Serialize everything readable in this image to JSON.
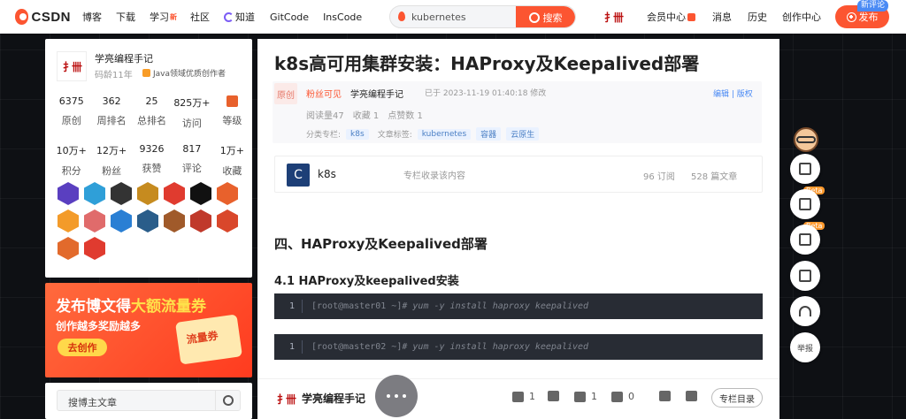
{
  "topbar": {
    "logo": "CSDN",
    "nav": [
      {
        "label": "博客",
        "hot": ""
      },
      {
        "label": "下载",
        "hot": ""
      },
      {
        "label": "学习",
        "hot": "新"
      },
      {
        "label": "社区",
        "hot": ""
      },
      {
        "label": "知道",
        "hot": ""
      },
      {
        "label": "GitCode",
        "hot": ""
      },
      {
        "label": "InsCode",
        "hot": ""
      }
    ],
    "search_query": "kubernetes",
    "search_button": "搜索",
    "member_center": "会员中心",
    "messages": "消息",
    "history": "历史",
    "creation_center": "创作中心",
    "publish": "发布",
    "new_comment": "新评论"
  },
  "profile": {
    "name": "学亮编程手记",
    "code_age": "码龄11年",
    "badge": "Java领域优质创作者",
    "stats_row1": [
      {
        "value": "6375",
        "label": "原创"
      },
      {
        "value": "362",
        "label": "周排名"
      },
      {
        "value": "25",
        "label": "总排名"
      },
      {
        "value": "825万+",
        "label": "访问"
      },
      {
        "value": "",
        "label": "等级"
      }
    ],
    "stats_row2": [
      {
        "value": "10万+",
        "label": "积分"
      },
      {
        "value": "12万+",
        "label": "粉丝"
      },
      {
        "value": "9326",
        "label": "获赞"
      },
      {
        "value": "817",
        "label": "评论"
      },
      {
        "value": "1万+",
        "label": "收藏"
      }
    ],
    "medal_colors": [
      "#5a3fc0",
      "#2f9fd8",
      "#333",
      "#c68b1f",
      "#e03b2f",
      "#111",
      "#e8612c",
      "#f39b2a",
      "#e06b6b",
      "#2a7fd4",
      "#2a5d8a",
      "#a05a2a",
      "#c0392b",
      "#d9472b",
      "#e26a2c",
      "#e03b2f"
    ]
  },
  "banner": {
    "title_a": "发布博文得",
    "title_b": "大额流量券",
    "subtitle": "创作越多奖励越多",
    "button": "去创作",
    "coupon": "流量券"
  },
  "blog_search": {
    "placeholder": "搜博主文章"
  },
  "article": {
    "title": "k8s高可用集群安装：HAProxy及Keepalived部署",
    "original": "原创",
    "fans_visible": "粉丝可见",
    "author": "学亮编程手记",
    "time": "已于 2023-11-19 01:40:18 修改",
    "edit": "编辑",
    "copyright": "版权",
    "reads": "阅读量47",
    "favorites": "收藏 1",
    "likes": "点赞数 1",
    "column_label": "分类专栏:",
    "column_tag": "k8s",
    "article_tags_label": "文章标签:",
    "tags": [
      "kubernetes",
      "容器",
      "云原生"
    ],
    "column_box": {
      "icon_letter": "C",
      "name": "k8s",
      "desc": "专栏收录该内容",
      "subs": "96 订阅",
      "posts": "528 篇文章"
    },
    "h2": "四、HAProxy及Keepalived部署",
    "h3": "4.1 HAProxy及keepalived安装",
    "code_blocks": [
      {
        "line": "1",
        "prompt": "[root@master01 ~]",
        "comment": "# yum -y install haproxy keepalived"
      },
      {
        "line": "1",
        "prompt": "[root@master02 ~]",
        "comment": "# yum -y install haproxy keepalived"
      }
    ]
  },
  "bottom_bar": {
    "name": "学亮编程手记",
    "likes": "1",
    "stars": "1",
    "comments": "0",
    "column_dir": "专栏目录"
  },
  "right_tools": {
    "beta": "Beta",
    "report": "举报"
  }
}
